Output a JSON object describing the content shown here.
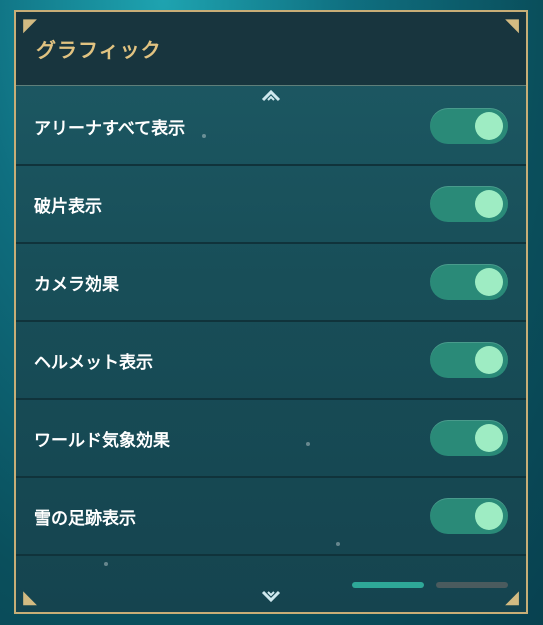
{
  "header": {
    "title": "グラフィック"
  },
  "settings": [
    {
      "label": "アリーナすべて表示",
      "enabled": true
    },
    {
      "label": "破片表示",
      "enabled": true
    },
    {
      "label": "カメラ効果",
      "enabled": true
    },
    {
      "label": "ヘルメット表示",
      "enabled": true
    },
    {
      "label": "ワールド気象効果",
      "enabled": true
    },
    {
      "label": "雪の足跡表示",
      "enabled": true
    }
  ],
  "colors": {
    "accent_gold": "#c7ae77",
    "toggle_on": "#2a8a78",
    "knob_on": "#9eecc3"
  },
  "icons": {
    "scroll_up": "chevron-up-icon",
    "scroll_down": "chevron-down-icon"
  }
}
